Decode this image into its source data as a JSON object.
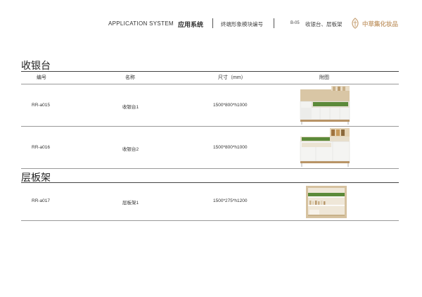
{
  "header": {
    "system_en": "APPLICATION SYSTEM",
    "system_cn": "应用系统",
    "module": "终端形象模块编号",
    "page_code": "B-05",
    "category": "收银台、层板架",
    "brand": "中草集化妆品",
    "brand_color": "#c9a47a"
  },
  "sections": [
    {
      "title": "收银台",
      "columns": [
        "编号",
        "名称",
        "尺寸（mm）",
        "附图"
      ],
      "rows": [
        {
          "code": "RR-a015",
          "name": "收银台1",
          "size": "1500*800*h1000",
          "image_icon": "cashier-counter-image"
        },
        {
          "code": "RR-a016",
          "name": "收银台2",
          "size": "1500*800*h1000",
          "image_icon": "cashier-counter-image"
        }
      ]
    },
    {
      "title": "层板架",
      "rows": [
        {
          "code": "RR-a017",
          "name": "层板架1",
          "size": "1500*275*h1200",
          "image_icon": "wall-shelf-image"
        }
      ]
    }
  ]
}
